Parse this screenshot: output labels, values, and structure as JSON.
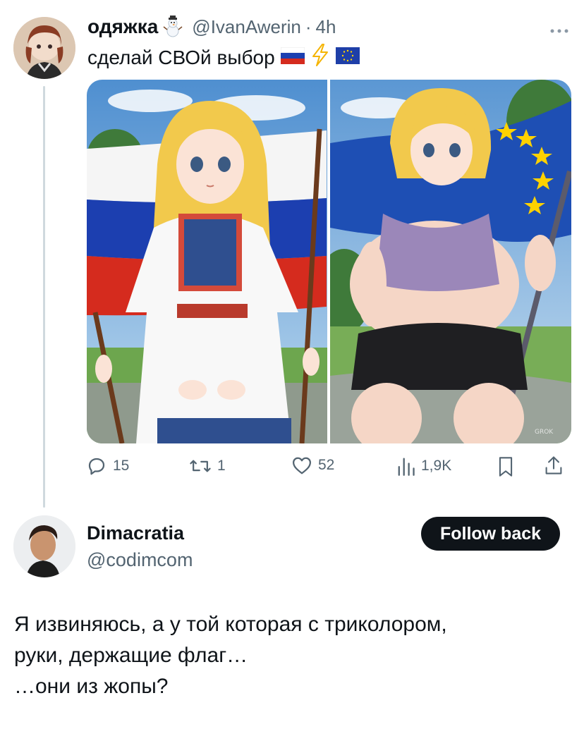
{
  "tweet": {
    "author_name": "одяжка",
    "author_handle": "@IvanAwerin",
    "separator": "·",
    "time": "4h",
    "text": "сделай СВОй выбор",
    "more_icon": "more-horizontal-icon",
    "name_badge_icon": "snowman-icon",
    "text_emojis": [
      "russia-flag-icon",
      "lightning-icon",
      "eu-flag-icon"
    ],
    "media": {
      "left_flag_colors": [
        "#ffffff",
        "#1c3fb0",
        "#d52b1e"
      ],
      "right_flag_color": "#1e4fb4",
      "watermark": "GROK"
    },
    "actions": {
      "replies": "15",
      "reposts": "1",
      "likes": "52",
      "views": "1,9K"
    }
  },
  "reply_user": {
    "name": "Dimacratia",
    "handle": "@codimcom",
    "follow_label": "Follow back"
  },
  "reply": {
    "lines": [
      "Я извиняюсь, а у той которая с триколором,",
      "руки, держащие флаг…",
      "…они из жопы?"
    ]
  },
  "colors": {
    "text": "#0f1419",
    "secondary": "#536471",
    "thread_line": "#cfd9de",
    "button_bg": "#0f1419"
  }
}
